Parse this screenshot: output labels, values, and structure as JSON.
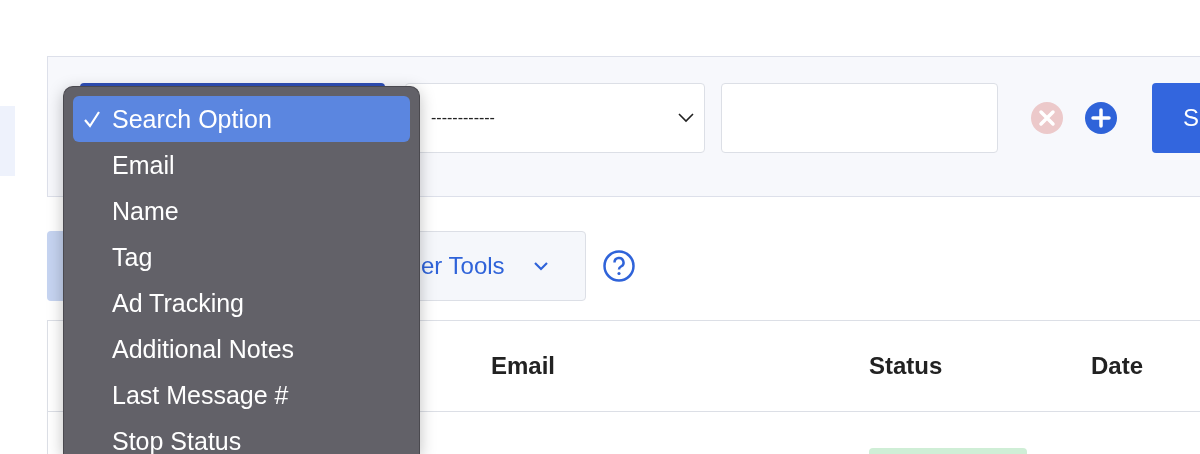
{
  "search_panel": {
    "operator_select": {
      "value": "------------"
    },
    "search_button": {
      "label": "S"
    }
  },
  "toolbar": {
    "tools_button": {
      "label": "er Tools"
    }
  },
  "table": {
    "columns": [
      {
        "label": "Email"
      },
      {
        "label": "Status"
      },
      {
        "label": "Date"
      }
    ]
  },
  "dropdown_menu": {
    "items": [
      {
        "label": "Search Option",
        "selected": true
      },
      {
        "label": "Email",
        "selected": false
      },
      {
        "label": "Name",
        "selected": false
      },
      {
        "label": "Tag",
        "selected": false
      },
      {
        "label": "Ad Tracking",
        "selected": false
      },
      {
        "label": "Additional Notes",
        "selected": false
      },
      {
        "label": "Last Message #",
        "selected": false
      },
      {
        "label": "Stop Status",
        "selected": false
      }
    ]
  }
}
